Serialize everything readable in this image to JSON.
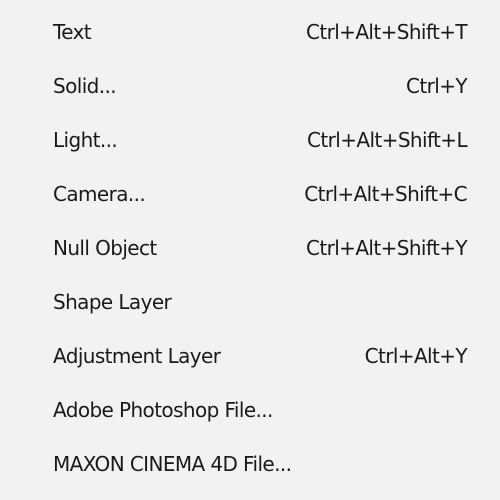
{
  "menu": {
    "items": [
      {
        "label": "Text",
        "shortcut": "Ctrl+Alt+Shift+T"
      },
      {
        "label": "Solid...",
        "shortcut": "Ctrl+Y"
      },
      {
        "label": "Light...",
        "shortcut": "Ctrl+Alt+Shift+L"
      },
      {
        "label": "Camera...",
        "shortcut": "Ctrl+Alt+Shift+C"
      },
      {
        "label": "Null Object",
        "shortcut": "Ctrl+Alt+Shift+Y"
      },
      {
        "label": "Shape Layer",
        "shortcut": ""
      },
      {
        "label": "Adjustment Layer",
        "shortcut": "Ctrl+Alt+Y"
      },
      {
        "label": "Adobe Photoshop File...",
        "shortcut": ""
      },
      {
        "label": "MAXON CINEMA 4D File...",
        "shortcut": ""
      }
    ]
  },
  "colors": {
    "background": "#f2f2f2",
    "text": "#1a1a1a"
  }
}
